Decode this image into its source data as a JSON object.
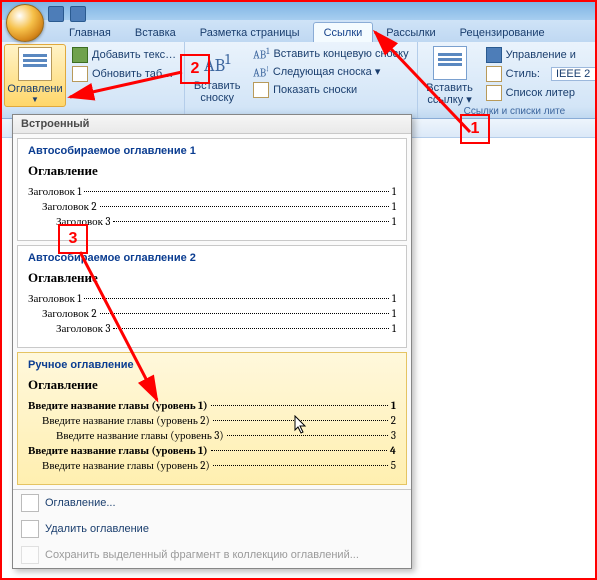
{
  "tabs": {
    "home": "Главная",
    "insert": "Вставка",
    "layout": "Разметка страницы",
    "references": "Ссылки",
    "mailings": "Рассылки",
    "review": "Рецензирование"
  },
  "ribbon": {
    "toc_label": "Оглавлени",
    "add_text": "Добавить текс…",
    "update_table": "Обновить таб…",
    "insert_footnote": "Вставить\nсноску",
    "footnote_group": {
      "ab_label": "AB",
      "sup": "1",
      "insert_endnote": "Вставить концевую сноску",
      "next_footnote": "Следующая сноска ▾",
      "show_footnotes": "Показать сноски"
    },
    "insert_link_label": "Вставить\nссылку ▾",
    "citations_group": {
      "manage_sources": "Управление и",
      "style_label": "Стиль:",
      "style_value": "IEEE 2",
      "bibliography": "Список литер"
    },
    "caption": "Ссылки и списки лите"
  },
  "dropdown": {
    "builtin_header": "Встроенный",
    "auto1_title": "Автособираемое оглавление 1",
    "auto2_title": "Автособираемое оглавление 2",
    "manual_title": "Ручное оглавление",
    "heading_word": "Оглавление",
    "auto_lines": [
      {
        "label": "Заголовок 1",
        "page": "1",
        "lvl": 1
      },
      {
        "label": "Заголовок 2",
        "page": "1",
        "lvl": 2
      },
      {
        "label": "Заголовок 3",
        "page": "1",
        "lvl": 3
      }
    ],
    "manual_lines": [
      {
        "label": "Введите название главы (уровень 1)",
        "page": "1",
        "lvl": 1,
        "bold": true
      },
      {
        "label": "Введите название главы (уровень 2)",
        "page": "2",
        "lvl": 2
      },
      {
        "label": "Введите название главы (уровень 3)",
        "page": "3",
        "lvl": 3
      },
      {
        "label": "Введите название главы (уровень 1)",
        "page": "4",
        "lvl": 1,
        "bold": true
      },
      {
        "label": "Введите название главы (уровень 2)",
        "page": "5",
        "lvl": 2
      }
    ],
    "footer": {
      "insert_toc": "Оглавление...",
      "remove_toc": "Удалить оглавление",
      "save_selection": "Сохранить выделенный фрагмент в коллекцию оглавлений..."
    }
  },
  "callouts": {
    "c1": "1",
    "c2": "2",
    "c3": "3"
  }
}
